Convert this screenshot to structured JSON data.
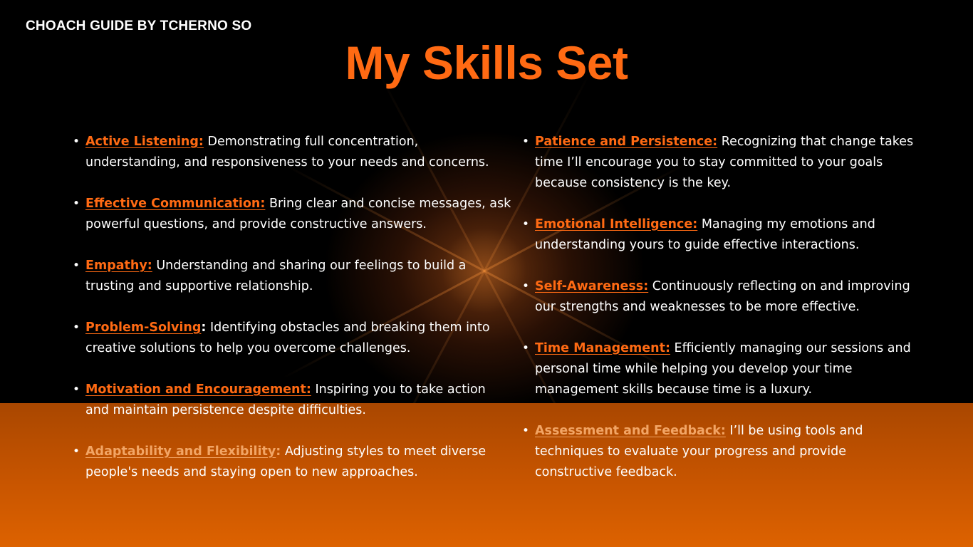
{
  "brand": "CHOACH GUIDE BY TCHERNO SO",
  "title": "My Skills Set",
  "colors": {
    "accent": "#ff6a13",
    "accent_light": "#f2a565",
    "text": "#ffffff",
    "background_top": "#000000",
    "background_bottom": "#c85500"
  },
  "left_items": [
    {
      "term": "Active Listening:",
      "colon": "",
      "desc": " Demonstrating full concentration, understanding, and responsiveness to your needs and concerns."
    },
    {
      "term": "Effective Communication:",
      "colon": "",
      "desc": " Bring clear and concise messages, ask powerful questions, and provide constructive answers."
    },
    {
      "term": "Empathy:",
      "colon": "",
      "desc": " Understanding and sharing our feelings to build a trusting and supportive relationship."
    },
    {
      "term": "Problem-Solving",
      "colon": ":",
      "desc": " Identifying obstacles and breaking them into creative solutions to help you overcome challenges."
    },
    {
      "term": "Motivation and Encouragement:",
      "colon": "",
      "desc": " Inspiring you to take action and maintain persistence despite difficulties."
    },
    {
      "term": "Adaptability and Flexibility",
      "colon": ":",
      "desc": " Adjusting styles to meet diverse people's needs and staying open to new approaches."
    }
  ],
  "right_items": [
    {
      "term": "Patience and Persistence:",
      "colon": "",
      "desc": " Recognizing that change takes time I’ll encourage you to stay committed to your goals because consistency is the key."
    },
    {
      "term": "Emotional Intelligence:",
      "colon": "",
      "desc": " Managing my emotions and understanding yours to guide effective interactions."
    },
    {
      "term": "Self-Awareness:",
      "colon": "",
      "desc": " Continuously reflecting on and improving our strengths and weaknesses to be more effective."
    },
    {
      "term": "Time Management:",
      "colon": "",
      "desc": " Efficiently managing our sessions and personal time while helping you develop your time management skills because time is a luxury."
    },
    {
      "term": "Assessment and Feedback:",
      "colon": "",
      "desc": " I’ll be using tools and techniques to evaluate your progress and provide constructive feedback."
    }
  ]
}
